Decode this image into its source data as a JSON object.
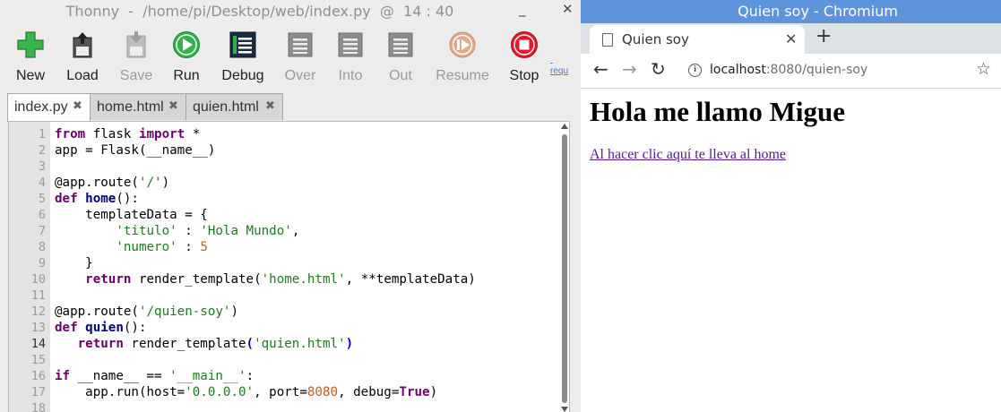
{
  "thonny": {
    "title": "Thonny  -  /home/pi/Desktop/web/index.py  @  14 : 40",
    "window_buttons": [
      "_",
      "✕"
    ],
    "toolbar": [
      {
        "label": "New",
        "enabled": true,
        "icon": "new-file-icon"
      },
      {
        "label": "Load",
        "enabled": true,
        "icon": "load-icon"
      },
      {
        "label": "Save",
        "enabled": false,
        "icon": "save-icon"
      },
      {
        "label": "Run",
        "enabled": true,
        "icon": "run-icon"
      },
      {
        "label": "Debug",
        "enabled": true,
        "icon": "debug-icon"
      },
      {
        "label": "Over",
        "enabled": false,
        "icon": "step-over-icon"
      },
      {
        "label": "Into",
        "enabled": false,
        "icon": "step-into-icon"
      },
      {
        "label": "Out",
        "enabled": false,
        "icon": "step-out-icon"
      },
      {
        "label": "Resume",
        "enabled": false,
        "icon": "resume-icon"
      },
      {
        "label": "Stop",
        "enabled": true,
        "icon": "stop-icon"
      }
    ],
    "side_link": "requ",
    "tabs": [
      {
        "label": "index.py",
        "active": true
      },
      {
        "label": "home.html",
        "active": false
      },
      {
        "label": "quien.html",
        "active": false
      }
    ],
    "tab_close": "✖",
    "current_line": 14,
    "code_lines": [
      [
        {
          "t": "from",
          "c": "kw"
        },
        {
          "t": " flask "
        },
        {
          "t": "import",
          "c": "kw"
        },
        {
          "t": " *"
        }
      ],
      [
        {
          "t": "app = Flask(__name__)"
        }
      ],
      [],
      [
        {
          "t": "@app.route("
        },
        {
          "t": "'/'",
          "c": "str"
        },
        {
          "t": ")"
        }
      ],
      [
        {
          "t": "def",
          "c": "kw"
        },
        {
          "t": " "
        },
        {
          "t": "home",
          "c": "fn"
        },
        {
          "t": "():"
        }
      ],
      [
        {
          "t": "    templateData = {"
        }
      ],
      [
        {
          "t": "        "
        },
        {
          "t": "'titulo'",
          "c": "str"
        },
        {
          "t": " : "
        },
        {
          "t": "'Hola Mundo'",
          "c": "str"
        },
        {
          "t": ","
        }
      ],
      [
        {
          "t": "        "
        },
        {
          "t": "'numero'",
          "c": "str"
        },
        {
          "t": " : "
        },
        {
          "t": "5",
          "c": "num"
        }
      ],
      [
        {
          "t": "    }"
        }
      ],
      [
        {
          "t": "    "
        },
        {
          "t": "return",
          "c": "kw"
        },
        {
          "t": " render_template("
        },
        {
          "t": "'home.html'",
          "c": "str"
        },
        {
          "t": ", **templateData)"
        }
      ],
      [],
      [
        {
          "t": "@app.route("
        },
        {
          "t": "'/quien-soy'",
          "c": "str"
        },
        {
          "t": ")"
        }
      ],
      [
        {
          "t": "def",
          "c": "kw"
        },
        {
          "t": " "
        },
        {
          "t": "quien",
          "c": "fn"
        },
        {
          "t": "():"
        }
      ],
      [
        {
          "t": "   "
        },
        {
          "t": "return",
          "c": "kw"
        },
        {
          "t": " render_template"
        },
        {
          "t": "(",
          "c": "paren"
        },
        {
          "t": "'quien.html'",
          "c": "str"
        },
        {
          "t": ")",
          "c": "paren"
        }
      ],
      [],
      [
        {
          "t": "if",
          "c": "kw"
        },
        {
          "t": " __name__ == "
        },
        {
          "t": "'__main__'",
          "c": "str"
        },
        {
          "t": ":"
        }
      ],
      [
        {
          "t": "    app.run(host="
        },
        {
          "t": "'0.0.0.0'",
          "c": "str"
        },
        {
          "t": ", port="
        },
        {
          "t": "8080",
          "c": "num"
        },
        {
          "t": ", debug="
        },
        {
          "t": "True",
          "c": "kw"
        },
        {
          "t": ")"
        }
      ],
      []
    ]
  },
  "chromium": {
    "title": "Quien soy - Chromium",
    "tab_title": "Quien soy",
    "tab_close": "✕",
    "new_tab": "+",
    "url_host": "localhost",
    "url_rest": ":8080/quien-soy",
    "page": {
      "heading": "Hola me llamo Migue",
      "link_text": "Al hacer clic aquí te lleva al home"
    }
  },
  "colors": {
    "chrome_titlebar": "#5f94dc",
    "keyword": "#6a006a",
    "string": "#1f7a1f",
    "number": "#c06020",
    "visited_link": "#551a8b"
  }
}
